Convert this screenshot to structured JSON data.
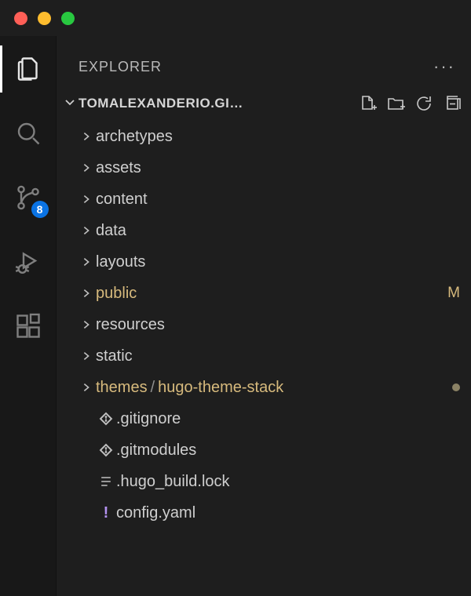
{
  "sidebar_title": "EXPLORER",
  "project_name": "TOMALEXANDERIO.GI…",
  "scm_badge": "8",
  "tree": {
    "folders": [
      {
        "label": "archetypes",
        "status": ""
      },
      {
        "label": "assets",
        "status": ""
      },
      {
        "label": "content",
        "status": ""
      },
      {
        "label": "data",
        "status": ""
      },
      {
        "label": "layouts",
        "status": ""
      },
      {
        "label": "public",
        "status": "M",
        "modified": true
      },
      {
        "label": "resources",
        "status": ""
      },
      {
        "label": "static",
        "status": ""
      }
    ],
    "themes": {
      "parent": "themes",
      "child": "hugo-theme-stack"
    },
    "files": [
      {
        "label": ".gitignore",
        "icon": "git"
      },
      {
        "label": ".gitmodules",
        "icon": "git"
      },
      {
        "label": ".hugo_build.lock",
        "icon": "lines"
      },
      {
        "label": "config.yaml",
        "icon": "yaml"
      }
    ]
  }
}
